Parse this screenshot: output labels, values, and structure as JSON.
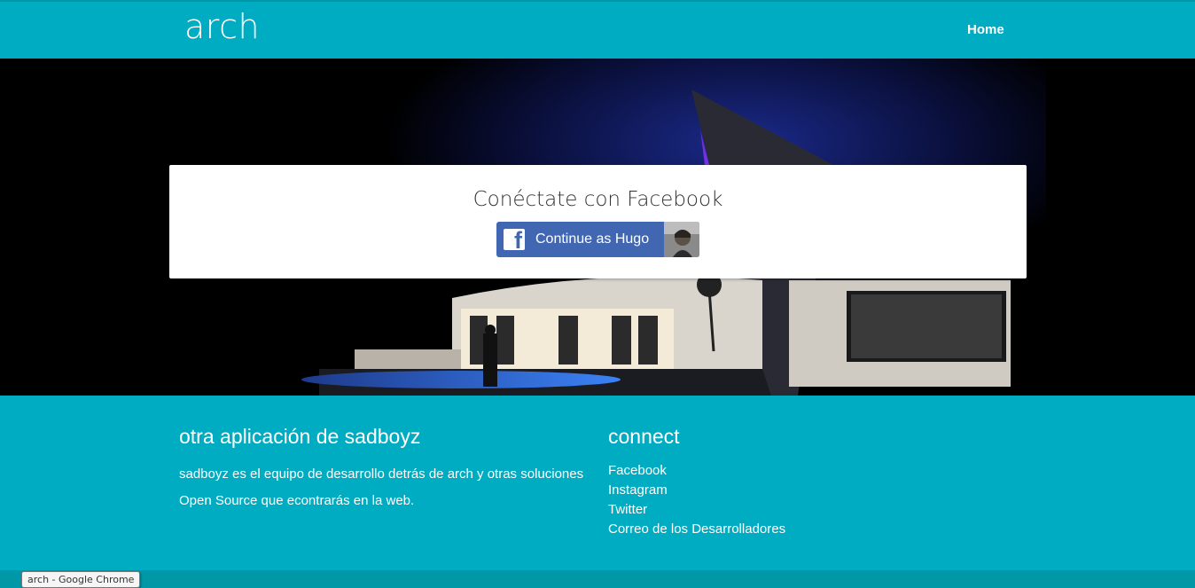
{
  "header": {
    "logo": "arch",
    "nav": {
      "home_label": "Home"
    }
  },
  "login_card": {
    "title": "Conéctate con Facebook",
    "facebook_button_label": "Continue as Hugo",
    "facebook_icon": "facebook-f-icon"
  },
  "footer": {
    "about": {
      "heading": "otra aplicación de sadboyz",
      "line1": "sadboyz es el equipo de desarrollo detrás de arch y otras soluciones",
      "line2": "Open Source que econtrarás en la web."
    },
    "connect": {
      "heading": "connect",
      "links": [
        "Facebook",
        "Instagram",
        "Twitter",
        "Correo de los Desarrolladores"
      ]
    }
  },
  "tooltip": "arch - Google Chrome",
  "colors": {
    "primary": "#00acc1",
    "facebook": "#4267b2",
    "card": "#ffffff"
  }
}
